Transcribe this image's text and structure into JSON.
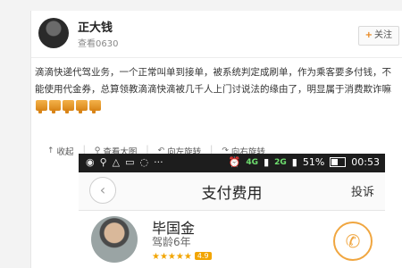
{
  "header": {
    "username": "正大钱",
    "subtitle": "查看0630",
    "follow_label": "关注"
  },
  "post": {
    "text": "滴滴快递代驾业务，一个正常叫单到接单，被系统判定成刷单，作为乘客要多付钱，不能使用代金券，总算领教滴滴快滴被几千人上门讨说法的缘由了，明显属于消费欺诈嘛",
    "emoji_name": "thumbs-down",
    "emoji_count": 5
  },
  "toolbar": {
    "collapse": "收起",
    "view_large": "查看大图",
    "rotate_left": "向左旋转",
    "rotate_right": "向右旋转"
  },
  "phone": {
    "status": {
      "net1": "4G",
      "net2": "2G",
      "battery": "51%",
      "time": "00:53"
    },
    "nav": {
      "title": "支付费用",
      "right": "投诉"
    },
    "driver": {
      "name": "毕国金",
      "age": "驾龄6年",
      "rating": "4.9",
      "stars": "★★★★★"
    }
  },
  "colors": {
    "accent": "#e8841a",
    "status_bar": "#1d1d1d",
    "call_button": "#f0a640"
  }
}
